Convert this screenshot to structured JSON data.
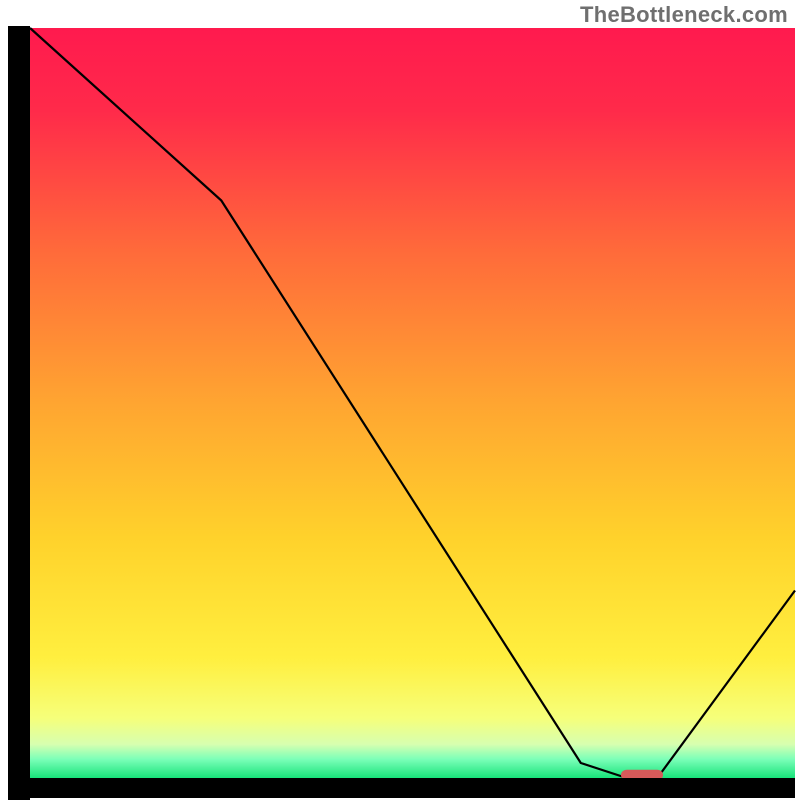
{
  "watermark": "TheBottleneck.com",
  "chart_data": {
    "type": "line",
    "title": "",
    "xlabel": "",
    "ylabel": "",
    "xlim": [
      0,
      100
    ],
    "ylim": [
      0,
      100
    ],
    "series": [
      {
        "name": "bottleneck-curve",
        "type": "line",
        "x": [
          0,
          25,
          72,
          78,
          82,
          100
        ],
        "y": [
          100,
          77,
          2,
          0,
          0,
          25
        ]
      },
      {
        "name": "optimal-marker",
        "type": "marker",
        "x": 80,
        "y": 0,
        "width_pct": 5.5,
        "height_pct": 1.4,
        "color": "#d65a5a"
      }
    ],
    "gradient_stops": [
      {
        "offset": 0.0,
        "color": "#ff1a4e"
      },
      {
        "offset": 0.11,
        "color": "#ff2a4a"
      },
      {
        "offset": 0.3,
        "color": "#ff6b3a"
      },
      {
        "offset": 0.5,
        "color": "#ffa531"
      },
      {
        "offset": 0.68,
        "color": "#ffd22b"
      },
      {
        "offset": 0.84,
        "color": "#ffef3f"
      },
      {
        "offset": 0.92,
        "color": "#f6ff7a"
      },
      {
        "offset": 0.955,
        "color": "#d7ffb0"
      },
      {
        "offset": 0.975,
        "color": "#7bffb8"
      },
      {
        "offset": 1.0,
        "color": "#18e37a"
      }
    ],
    "background_color": "#ffffff",
    "plot_axis_color": "#000000"
  }
}
